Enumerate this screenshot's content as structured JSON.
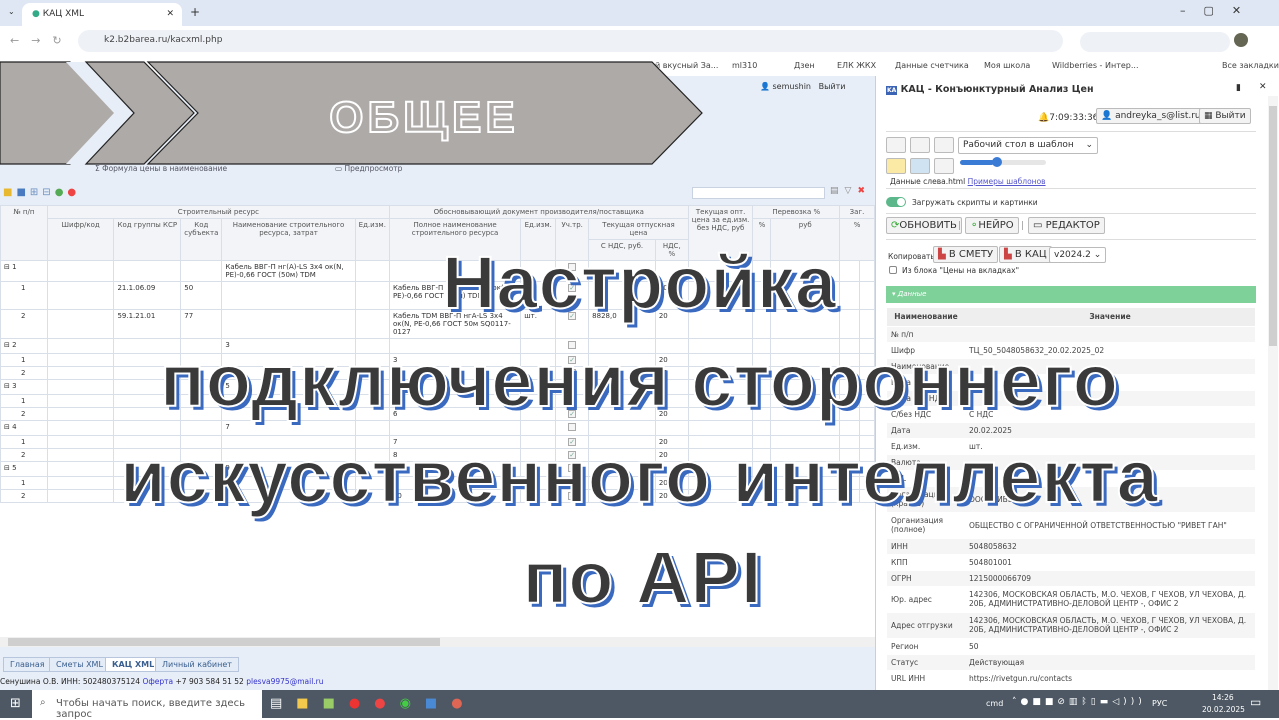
{
  "browser": {
    "tab_title": "КАЦ XML",
    "url": "k2.b2barea.ru/kacxml.php",
    "bookmarks": [
      "й вкусный За...",
      "ml310",
      "Дзен",
      "ЕЛК ЖКХ",
      "Данные счетчика",
      "Моя школа",
      "Wildberries - Интер...",
      "Все закладки"
    ]
  },
  "app": {
    "user": "semushin",
    "logout": "Выйти",
    "toolbar": [
      "Формула цены в наименование",
      "Предпросмотр"
    ]
  },
  "banner": {
    "label": "ОБЩЕЕ"
  },
  "grid": {
    "groups": [
      "№ п/п",
      "Строительный ресурс",
      "Обосновывающий документ производителя/поставщика",
      "Текущая опт. цена за ед.изм. без НДС, руб",
      "Перевозка %",
      "Заг."
    ],
    "columns": [
      "Шифр/код",
      "Код группы КСР",
      "Код субъекта",
      "Наименование строительного ресурса, затрат",
      "Ед.изм.",
      "Полное наименование строительного ресурса",
      "Ед.изм.",
      "Уч.тр.",
      "Текущая отпускная цена",
      "С НДС, руб.",
      "НДС, %",
      "%",
      "руб",
      "%"
    ],
    "rows": [
      {
        "n": "1",
        "level": 0,
        "ksr": "",
        "subj": "",
        "name": "Кабель ВВГ-П нг(А)-LS 3х4 ок(N, PE)-0,66 ГОСТ (50м) TDM",
        "full": "",
        "unit": "",
        "chk": false,
        "price": "",
        "vat": ""
      },
      {
        "n": "1",
        "level": 1,
        "ksr": "21.1.06.09",
        "subj": "50",
        "name": "",
        "full": "Кабель ВВГ-П нг(А)-LS 3х4 ок(N, PE)-0,66 ГОСТ (50м) TDM",
        "unit": "шт.",
        "chk": true,
        "price": "",
        "vat": "20"
      },
      {
        "n": "2",
        "level": 1,
        "ksr": "59.1.21.01",
        "subj": "77",
        "name": "",
        "full": "Кабель TDM ВВГ-П нгА-LS 3х4 ок(N, PE-0,66 ГОСТ 50м SQ0117-0127",
        "unit": "шт.",
        "chk": true,
        "price": "8828,0",
        "vat": "20"
      },
      {
        "n": "2",
        "level": 0,
        "name": "3",
        "full": "",
        "chk": false,
        "vat": ""
      },
      {
        "n": "1",
        "level": 1,
        "name": "",
        "full": "3",
        "chk": true,
        "vat": "20"
      },
      {
        "n": "2",
        "level": 1,
        "name": "",
        "full": "4",
        "chk": true,
        "vat": "20"
      },
      {
        "n": "3",
        "level": 0,
        "name": "5",
        "full": "",
        "chk": false,
        "vat": ""
      },
      {
        "n": "1",
        "level": 1,
        "name": "",
        "full": "5",
        "chk": true,
        "vat": "20"
      },
      {
        "n": "2",
        "level": 1,
        "name": "",
        "full": "6",
        "chk": true,
        "vat": "20"
      },
      {
        "n": "4",
        "level": 0,
        "name": "7",
        "full": "",
        "chk": false,
        "vat": ""
      },
      {
        "n": "1",
        "level": 1,
        "name": "",
        "full": "7",
        "chk": true,
        "vat": "20"
      },
      {
        "n": "2",
        "level": 1,
        "name": "",
        "full": "8",
        "chk": true,
        "vat": "20"
      },
      {
        "n": "5",
        "level": 0,
        "name": "9",
        "full": "",
        "chk": false,
        "vat": ""
      },
      {
        "n": "1",
        "level": 1,
        "name": "",
        "full": "9",
        "chk": true,
        "vat": "20"
      },
      {
        "n": "2",
        "level": 1,
        "name": "",
        "full": "10",
        "chk": true,
        "vat": "20"
      }
    ]
  },
  "bottom_tabs": [
    "Главная",
    "Сметы XML",
    "КАЦ XML",
    "Личный кабинет"
  ],
  "footer": {
    "text": "Сенушина О.В. ИНН: 502480375124",
    "offer": "Оферта",
    "phone": "+7 903 584 51 52",
    "email": "plesva9975@mail.ru"
  },
  "panel": {
    "title": "КАЦ - Конъюнктурный Анализ Цен",
    "time": "7:09:33:36",
    "email": "andreyka_s@list.ru",
    "logout": "Выйти",
    "template_select": "Рабочий стол в шаблон",
    "data_file": "Данные слева.html",
    "examples_link": "Примеры шаблонов",
    "slider_value": 0.4,
    "toggle_label": "Загружать скрипты и картинки",
    "toggle_on": true,
    "refresh": "ОБНОВИТЬ",
    "neuro": "НЕЙРО",
    "editor": "РЕДАКТОР",
    "copy_label": "Копировать:",
    "to_estimate": "В СМЕТУ",
    "to_kac": "В КАЦ",
    "version": "v2024.2",
    "from_block": "Из блока \"Цены на вкладках\"",
    "section": "▾ Данные",
    "col_name": "Наименование",
    "col_value": "Значение",
    "rows": [
      [
        "№ п/п",
        ""
      ],
      [
        "Шифр",
        "ТЦ_50_5048058632_20.02.2025_02"
      ],
      [
        "Наименование",
        ""
      ],
      [
        "Цена",
        ""
      ],
      [
        "Цена без НДС",
        ""
      ],
      [
        "С/без НДС",
        "С НДС"
      ],
      [
        "Дата",
        "20.02.2025"
      ],
      [
        "Ед.изм.",
        "шт."
      ],
      [
        "Валюта",
        ""
      ],
      [
        "URL",
        ""
      ],
      [
        "Организация (кратко)",
        "ООО \"РИВЕТ ГАН\""
      ],
      [
        "Организация (полное)",
        "ОБЩЕСТВО С ОГРАНИЧЕННОЙ ОТВЕТСТВЕННОСТЬЮ \"РИВЕТ ГАН\""
      ],
      [
        "ИНН",
        "5048058632"
      ],
      [
        "КПП",
        "504801001"
      ],
      [
        "ОГРН",
        "1215000066709"
      ],
      [
        "Юр. адрес",
        "142306, МОСКОВСКАЯ ОБЛАСТЬ, М.О. ЧЕХОВ, Г ЧЕХОВ, УЛ ЧЕХОВА, Д. 20Б, АДМИНИСТРАТИВНО-ДЕЛОВОЙ ЦЕНТР -, ОФИС 2"
      ],
      [
        "Адрес отгрузки",
        "142306, МОСКОВСКАЯ ОБЛАСТЬ, М.О. ЧЕХОВ, Г ЧЕХОВ, УЛ ЧЕХОВА, Д. 20Б, АДМИНИСТРАТИВНО-ДЕЛОВОЙ ЦЕНТР -, ОФИС 2"
      ],
      [
        "Регион",
        "50"
      ],
      [
        "Статус",
        "Действующая"
      ],
      [
        "URL ИНН",
        "https://rivetgun.ru/contacts"
      ]
    ]
  },
  "overlay": {
    "lines": [
      "Настройка",
      "подключения стороннего",
      "искусственного интеллекта",
      "по API"
    ]
  },
  "taskbar": {
    "search_placeholder": "Чтобы начать поиск, введите здесь запрос",
    "tray_cmd": "cmd",
    "lang": "РУС",
    "time": "14:26",
    "date": "20.02.2025"
  },
  "colors": {
    "accent_green": "#7fd19a",
    "banner_gray": "#aeaaa8",
    "overlay_shadow": "#3a69c0"
  }
}
